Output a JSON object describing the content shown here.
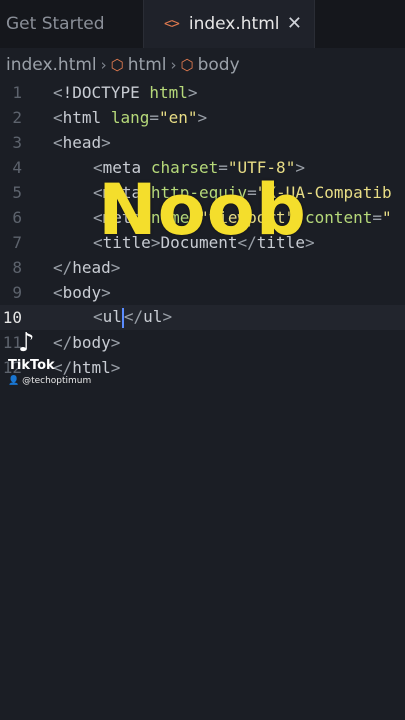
{
  "tabs": [
    {
      "label": "Get Started"
    },
    {
      "label": "index.html",
      "icon": "code-icon",
      "close": "✕"
    }
  ],
  "breadcrumb": [
    "index.html",
    "html",
    "body"
  ],
  "editor": {
    "lines": [
      {
        "num": "1",
        "code": "<!DOCTYPE html>"
      },
      {
        "num": "2",
        "code": "<html lang=\"en\">"
      },
      {
        "num": "3",
        "code": "<head>"
      },
      {
        "num": "4",
        "code": "<meta charset=\"UTF-8\">"
      },
      {
        "num": "5",
        "code": "<meta http-equiv=\"X-UA-Compatib"
      },
      {
        "num": "6",
        "code": "<meta name=\"viewport\" content=\""
      },
      {
        "num": "7",
        "code": "<title>Document</title>"
      },
      {
        "num": "8",
        "code": "</head>"
      },
      {
        "num": "9",
        "code": "<body>"
      },
      {
        "num": "10",
        "code": "<ul></ul>"
      },
      {
        "num": "11",
        "code": "</body>"
      },
      {
        "num": "12",
        "code": "</html>"
      }
    ],
    "active_line": "10"
  },
  "overlay_text": "Noob",
  "watermark": {
    "brand": "TikTok",
    "handle": "@techoptimum"
  },
  "colors": {
    "accent": "#f4de2c",
    "cursor": "#5b8cff"
  }
}
